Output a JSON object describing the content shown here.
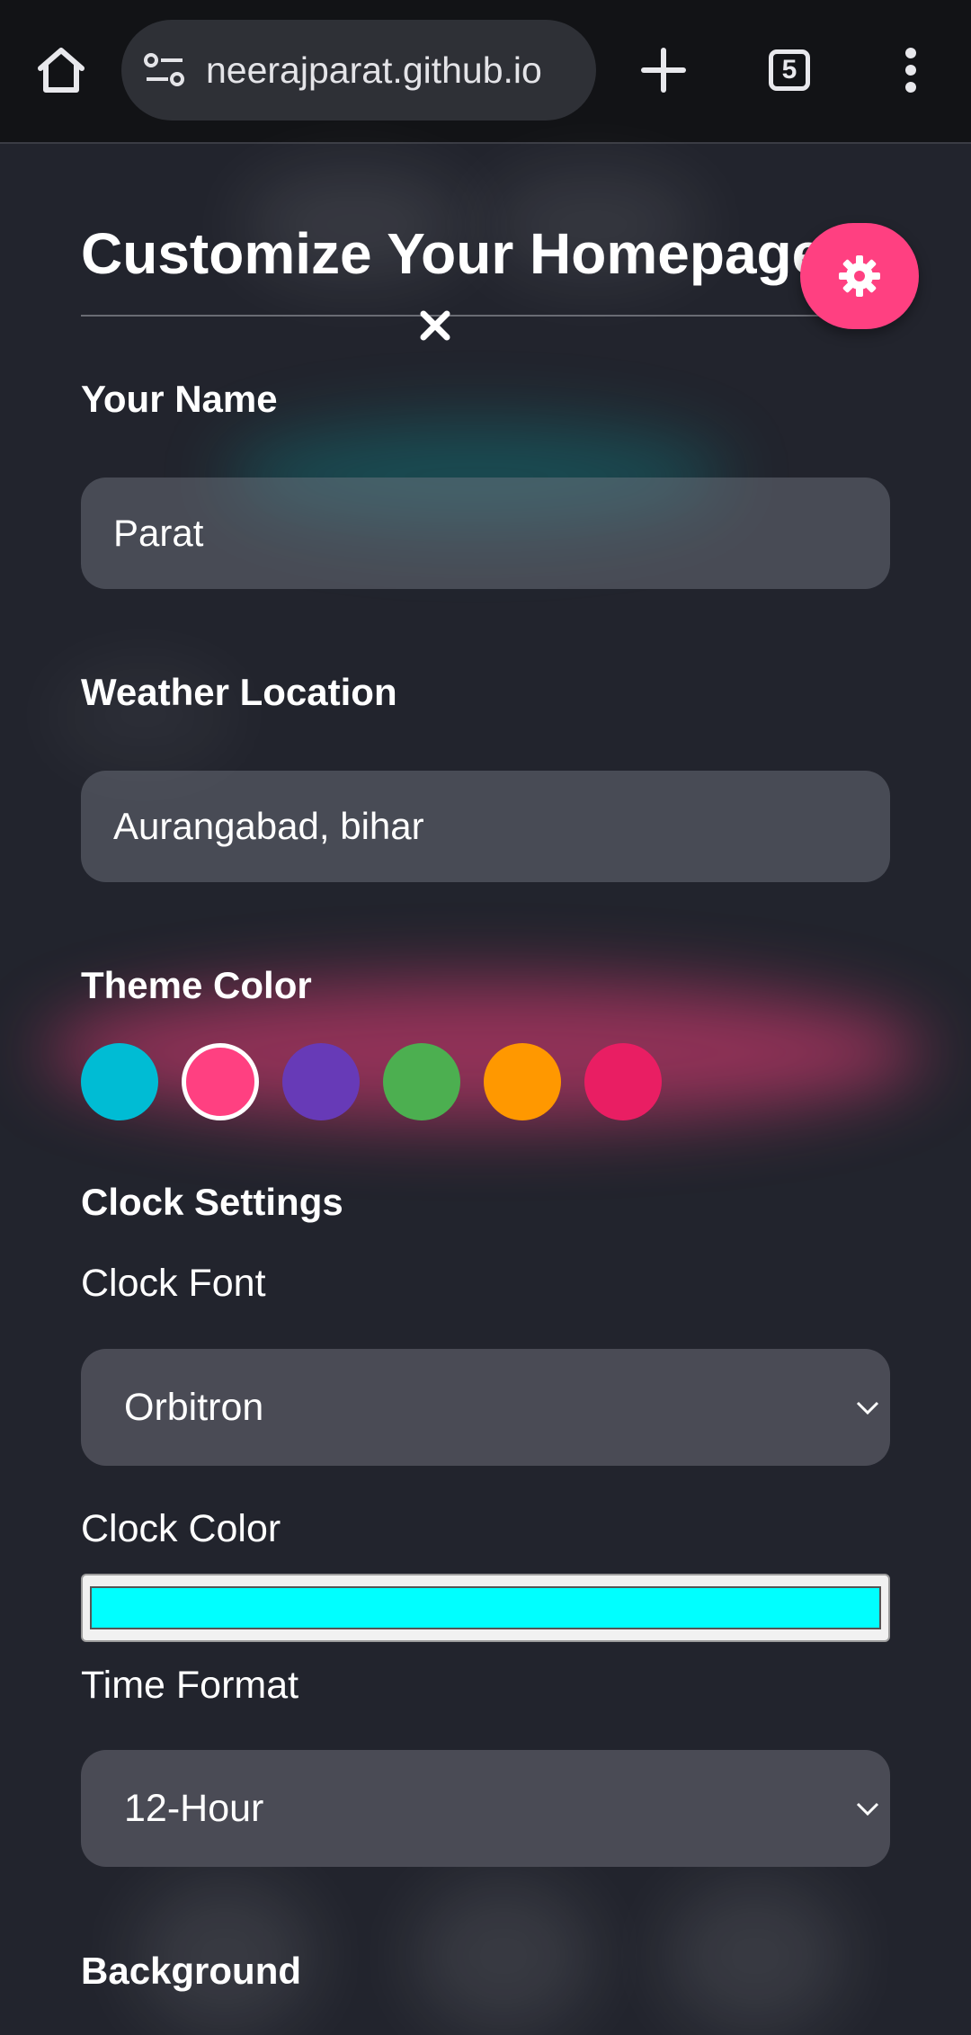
{
  "browser": {
    "url": "neerajparat.github.io",
    "tab_count": "5"
  },
  "page": {
    "title": "Customize Your Homepage",
    "name_label": "Your Name",
    "name_value": "Parat",
    "location_label": "Weather Location",
    "location_value": "Aurangabad, bihar",
    "theme_label": "Theme Color",
    "theme_colors": [
      "#00bcd4",
      "#ff4081",
      "#673ab7",
      "#4caf50",
      "#ff9800",
      "#e91e63"
    ],
    "theme_selected": "#ff4081",
    "clock_section_label": "Clock Settings",
    "clock_font_label": "Clock Font",
    "clock_font_value": "Orbitron",
    "clock_color_label": "Clock Color",
    "clock_color_value": "#00ffff",
    "time_format_label": "Time Format",
    "time_format_value": "12-Hour",
    "background_label": "Background"
  }
}
